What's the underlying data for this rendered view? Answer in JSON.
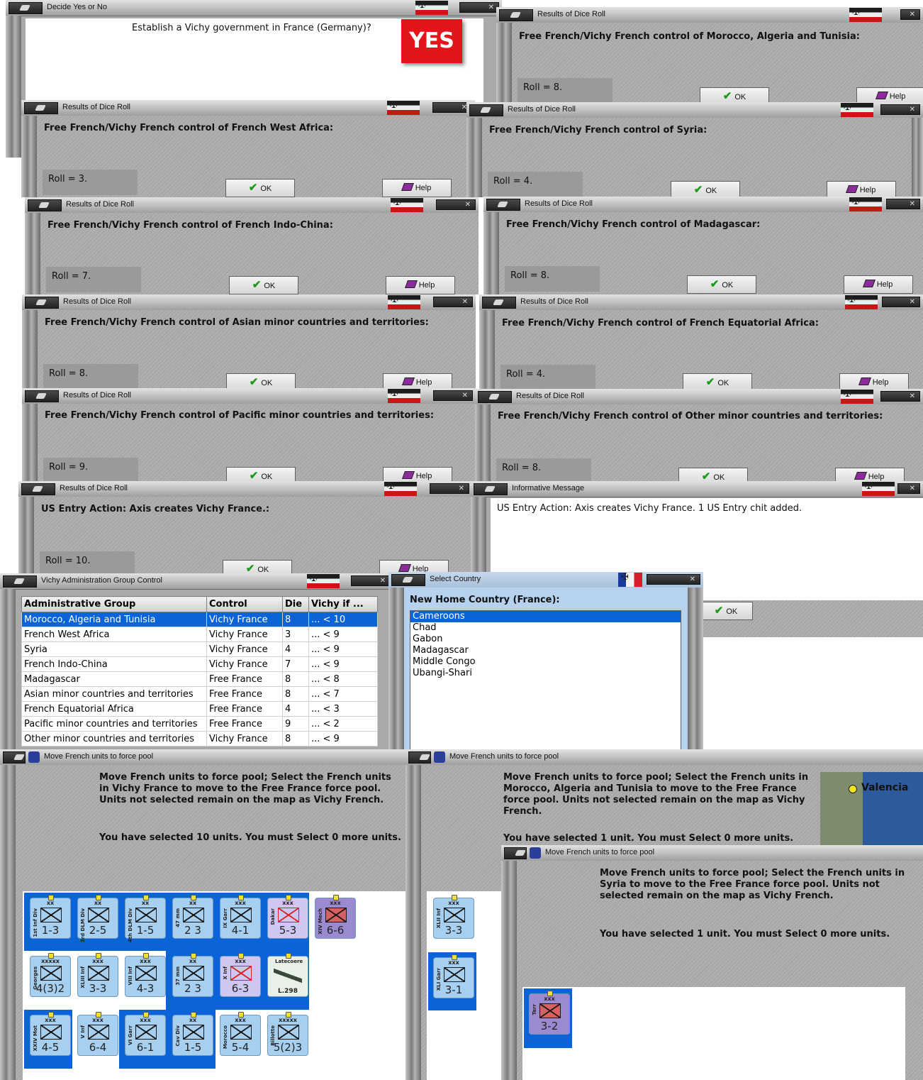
{
  "decide": {
    "title": "Decide Yes or No",
    "question": "Establish a Vichy government in France (Germany)?",
    "yes_label": "YES"
  },
  "dice": [
    {
      "title": "Results of Dice Roll",
      "message": "Free French/Vichy French control of Morocco, Algeria and Tunisia:",
      "roll": "Roll = 8."
    },
    {
      "title": "Results of Dice Roll",
      "message": "Free French/Vichy French control of French West Africa:",
      "roll": "Roll = 3."
    },
    {
      "title": "Results of Dice Roll",
      "message": "Free French/Vichy French control of Syria:",
      "roll": "Roll = 4."
    },
    {
      "title": "Results of Dice Roll",
      "message": "Free French/Vichy French control of French Indo-China:",
      "roll": "Roll = 7."
    },
    {
      "title": "Results of Dice Roll",
      "message": "Free French/Vichy French control of Madagascar:",
      "roll": "Roll = 8."
    },
    {
      "title": "Results of Dice Roll",
      "message": "Free French/Vichy French control of Asian minor countries and territories:",
      "roll": "Roll = 8."
    },
    {
      "title": "Results of Dice Roll",
      "message": "Free French/Vichy French control of French Equatorial Africa:",
      "roll": "Roll = 4."
    },
    {
      "title": "Results of Dice Roll",
      "message": "Free French/Vichy French control of Pacific minor countries and territories:",
      "roll": "Roll = 9."
    },
    {
      "title": "Results of Dice Roll",
      "message": "Free French/Vichy French control of Other minor countries and territories:",
      "roll": "Roll = 8."
    },
    {
      "title": "Results of Dice Roll",
      "message": "US Entry Action: Axis creates Vichy France.:",
      "roll": "Roll = 10."
    }
  ],
  "buttons": {
    "ok": "OK",
    "help": "Help"
  },
  "info": {
    "title": "Informative Message",
    "message": "US Entry Action: Axis creates Vichy France.  1 US Entry chit added."
  },
  "vichy_table": {
    "title": "Vichy Administration Group Control",
    "columns": [
      "Administrative Group",
      "Control",
      "Die",
      "Vichy if ..."
    ],
    "rows": [
      [
        "Morocco, Algeria and Tunisia",
        "Vichy France",
        "8",
        "... < 10"
      ],
      [
        "French West Africa",
        "Vichy France",
        "3",
        "... < 9"
      ],
      [
        "Syria",
        "Vichy France",
        "4",
        "... < 9"
      ],
      [
        "French Indo-China",
        "Vichy France",
        "7",
        "... < 9"
      ],
      [
        "Madagascar",
        "Free France",
        "8",
        "... < 8"
      ],
      [
        "Asian minor countries and territories",
        "Free France",
        "8",
        "... < 7"
      ],
      [
        "French Equatorial Africa",
        "Free France",
        "4",
        "... < 3"
      ],
      [
        "Pacific minor countries and territories",
        "Free France",
        "9",
        "... < 2"
      ],
      [
        "Other minor countries and territories",
        "Vichy France",
        "8",
        "... < 9"
      ]
    ]
  },
  "select_country": {
    "title": "Select Country",
    "heading": "New Home Country (France):",
    "options": [
      "Cameroons",
      "Chad",
      "Gabon",
      "Madagascar",
      "Middle Congo",
      "Ubangi-Shari"
    ],
    "selected": "Cameroons"
  },
  "move_units": [
    {
      "title": "Move French units to force pool",
      "text": "Move French units to force pool; Select the French units in Vichy France to move to the Free France force pool.  Units not selected remain on the map as Vichy French.",
      "status": "You have selected 10 units.  You must Select 0 more units."
    },
    {
      "title": "Move French units to force pool",
      "text": "Move French units to force pool; Select the French units in Morocco, Algeria and Tunisia to move to the Free France force pool.  Units not selected remain on the map as Vichy French.",
      "status": "You have selected 1 unit.  You must Select 0 more units."
    },
    {
      "title": "Move French units to force pool",
      "text": "Move French units to force pool; Select the French units in Syria to move to the Free France force pool.  Units not selected remain on the map as Vichy French.",
      "status": "You have selected 1 unit.  You must Select 0 more units."
    }
  ],
  "map_label": "Valencia",
  "counters_pool1": [
    {
      "size": "xx",
      "side": "1st Inf Div",
      "str": "1-3",
      "kind": "blue"
    },
    {
      "size": "xx",
      "side": "3rd DLM Div",
      "str": "2-5",
      "kind": "blue"
    },
    {
      "size": "xx",
      "side": "4th DLM Div",
      "str": "1-5",
      "kind": "blue"
    },
    {
      "size": "xx",
      "side": "47 mm",
      "str": "2 3",
      "kind": "blue"
    },
    {
      "size": "xxx",
      "side": "IX Garr",
      "str": "4-1",
      "kind": "blue"
    },
    {
      "size": "xxx",
      "side": "Dakar",
      "str": "5-3",
      "kind": "red"
    },
    {
      "size": "xxx",
      "side": "XIV Mech",
      "str": "6-6",
      "kind": "purple"
    },
    {
      "size": "xxxxx",
      "side": "Georges",
      "str": "4(3)2",
      "kind": "blue"
    },
    {
      "size": "xxx",
      "side": "XLIII Inf",
      "str": "3-3",
      "kind": "blue"
    },
    {
      "size": "xxx",
      "side": "VIII Inf",
      "str": "4-3",
      "kind": "blue"
    },
    {
      "size": "xx",
      "side": "37 mm",
      "str": "2 3",
      "kind": "blue"
    },
    {
      "size": "xxx",
      "side": "X Inf",
      "str": "6-3",
      "kind": "red"
    },
    {
      "size": "",
      "side": "Latecoere",
      "str": "L.298",
      "kind": "plane"
    },
    {
      "size": "xxx",
      "side": "XXIV Mot",
      "str": "4-5",
      "kind": "blue"
    },
    {
      "size": "xxx",
      "side": "V Inf",
      "str": "6-4",
      "kind": "blue"
    },
    {
      "size": "xxx",
      "side": "VI Garr",
      "str": "6-1",
      "kind": "blue"
    },
    {
      "size": "xx",
      "side": "Cav Div",
      "str": "1-5",
      "kind": "blue"
    },
    {
      "size": "xxx",
      "side": "Morocco",
      "str": "5-4",
      "kind": "blue"
    },
    {
      "size": "xxxxx",
      "side": "Billotte",
      "str": "5(2)3",
      "kind": "blue"
    }
  ],
  "counters_pool2": [
    {
      "size": "xxx",
      "side": "XLII Inf",
      "str": "3-3",
      "kind": "blue"
    },
    {
      "size": "xxx",
      "side": "XLI Garr",
      "str": "3-1",
      "kind": "blue"
    }
  ],
  "counters_pool3": [
    {
      "size": "xxx",
      "side": "Terr",
      "str": "3-2",
      "kind": "purple"
    }
  ]
}
